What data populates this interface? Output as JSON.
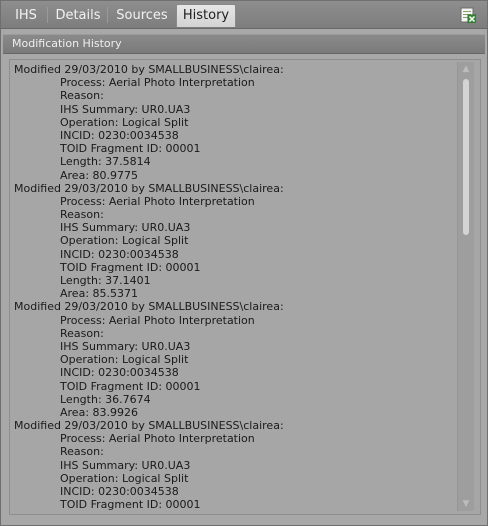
{
  "tabs": [
    {
      "label": "IHS",
      "active": false
    },
    {
      "label": "Details",
      "active": false
    },
    {
      "label": "Sources",
      "active": false
    },
    {
      "label": "History",
      "active": true
    }
  ],
  "toolbar": {
    "export_icon": "export-to-excel-icon"
  },
  "section": {
    "title": "Modification History"
  },
  "history": [
    {
      "header": "Modified 29/03/2010 by SMALLBUSINESS\\clairea:",
      "process": "Process: Aerial Photo Interpretation",
      "reason": "Reason:",
      "ihs_summary": "IHS Summary: UR0.UA3",
      "operation": "Operation: Logical Split",
      "incid": "INCID: 0230:0034538",
      "toid_fragment": "TOID Fragment ID: 00001",
      "length": "Length: 37.5814",
      "area": "Area: 80.9775"
    },
    {
      "header": "Modified 29/03/2010 by SMALLBUSINESS\\clairea:",
      "process": "Process: Aerial Photo Interpretation",
      "reason": "Reason:",
      "ihs_summary": "IHS Summary: UR0.UA3",
      "operation": "Operation: Logical Split",
      "incid": "INCID: 0230:0034538",
      "toid_fragment": "TOID Fragment ID: 00001",
      "length": "Length: 37.1401",
      "area": "Area: 85.5371"
    },
    {
      "header": "Modified 29/03/2010 by SMALLBUSINESS\\clairea:",
      "process": "Process: Aerial Photo Interpretation",
      "reason": "Reason:",
      "ihs_summary": "IHS Summary: UR0.UA3",
      "operation": "Operation: Logical Split",
      "incid": "INCID: 0230:0034538",
      "toid_fragment": "TOID Fragment ID: 00001",
      "length": "Length: 36.7674",
      "area": "Area: 83.9926"
    },
    {
      "header": "Modified 29/03/2010 by SMALLBUSINESS\\clairea:",
      "process": "Process: Aerial Photo Interpretation",
      "reason": "Reason:",
      "ihs_summary": "IHS Summary: UR0.UA3",
      "operation": "Operation: Logical Split",
      "incid": "INCID: 0230:0034538",
      "toid_fragment": "TOID Fragment ID: 00001"
    }
  ],
  "scrollbar": {
    "up_icon": "scroll-up-arrow-icon",
    "down_icon": "scroll-down-arrow-icon"
  }
}
